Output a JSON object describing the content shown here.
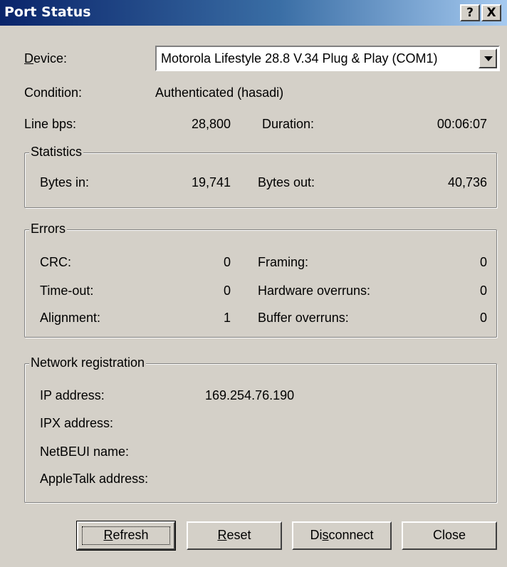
{
  "window": {
    "title": "Port Status"
  },
  "titlebar_buttons": {
    "help": "?",
    "close": "X"
  },
  "device": {
    "label": "Device:",
    "selected": "Motorola Lifestyle 28.8 V.34 Plug & Play (COM1)"
  },
  "condition": {
    "label": "Condition:",
    "value": "Authenticated (hasadi)"
  },
  "line": {
    "bps_label": "Line bps:",
    "bps_value": "28,800",
    "duration_label": "Duration:",
    "duration_value": "00:06:07"
  },
  "statistics": {
    "title": "Statistics",
    "bytes_in_label": "Bytes in:",
    "bytes_in_value": "19,741",
    "bytes_out_label": "Bytes out:",
    "bytes_out_value": "40,736"
  },
  "errors": {
    "title": "Errors",
    "crc_label": "CRC:",
    "crc_value": "0",
    "timeout_label": "Time-out:",
    "timeout_value": "0",
    "alignment_label": "Alignment:",
    "alignment_value": "1",
    "framing_label": "Framing:",
    "framing_value": "0",
    "hw_overruns_label": "Hardware overruns:",
    "hw_overruns_value": "0",
    "buffer_overruns_label": "Buffer overruns:",
    "buffer_overruns_value": "0"
  },
  "network": {
    "title": "Network registration",
    "ip_label": "IP address:",
    "ip_value": "169.254.76.190",
    "ipx_label": "IPX address:",
    "netbeui_label": "NetBEUI name:",
    "appletalk_label": "AppleTalk address:"
  },
  "buttons": {
    "refresh": "Refresh",
    "reset": "Reset",
    "disconnect": "Disconnect",
    "close": "Close"
  }
}
